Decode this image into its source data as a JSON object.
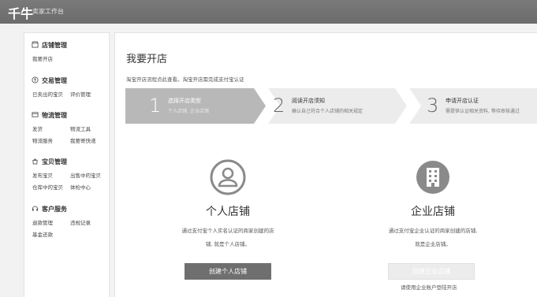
{
  "header": {
    "logo": "千牛",
    "subtitle": "卖家工作台"
  },
  "sidebar": {
    "sections": [
      {
        "title": "店铺管理",
        "icon": "shop-icon",
        "links": [
          "我要开店"
        ]
      },
      {
        "title": "交易管理",
        "icon": "transaction-icon",
        "links": [
          "已卖出的宝贝",
          "评价管理"
        ]
      },
      {
        "title": "物流管理",
        "icon": "logistics-icon",
        "links": [
          "发货",
          "物流工具",
          "物流服务",
          "我要寄快递"
        ]
      },
      {
        "title": "宝贝管理",
        "icon": "goods-icon",
        "links": [
          "发布宝贝",
          "出售中的宝贝",
          "仓库中的宝贝",
          "体检中心"
        ]
      },
      {
        "title": "客户服务",
        "icon": "service-icon",
        "links": [
          "退款管理",
          "违规记录",
          "基金还款"
        ]
      }
    ]
  },
  "main": {
    "title": "我要开店",
    "notice": "淘宝开店流程点此查看。淘宝开店需完成支付宝认证",
    "steps": [
      {
        "num": "1",
        "title": "选择开店类型",
        "desc": "个人店铺, 企业店铺",
        "active": true
      },
      {
        "num": "2",
        "title": "阅读开店须知",
        "desc": "确认自己符合个人店铺的相关规定",
        "active": false
      },
      {
        "num": "3",
        "title": "申请开店认证",
        "desc": "需提供认证相关资料, 等待审核通过",
        "active": false
      }
    ],
    "personal": {
      "title": "个人店铺",
      "desc": "通过支付宝个人实名认证的商家创建的店铺, 就是个人店铺。",
      "button": "创建个人店铺"
    },
    "enterprise": {
      "title": "企业店铺",
      "desc": "通过支付宝企业认证的商家创建的店铺, 就是企业店铺。",
      "button": "创建企业店铺",
      "note": "请使用企业账户登陆开店"
    }
  },
  "colors": {
    "topbar": "#6f6f6f",
    "active_step": "#b8b8b8",
    "step_bg": "#ececec",
    "icon": "#8a8a8a"
  }
}
